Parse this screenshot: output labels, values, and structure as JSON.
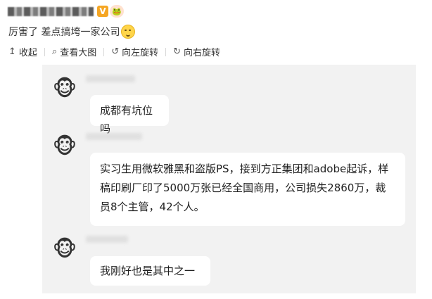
{
  "post": {
    "v_badge": "V",
    "level_badge": "🐸",
    "text": "厉害了 差点搞垮一家公司",
    "emoji": "sneaky-smile-emoji"
  },
  "toolbar": {
    "collapse": "收起",
    "view_large": "查看大图",
    "rotate_left": "向左旋转",
    "rotate_right": "向右旋转",
    "icons": {
      "collapse": "↥",
      "view_large": "⌕",
      "rotate_left": "↺",
      "rotate_right": "↻"
    }
  },
  "chat": {
    "avatar_glyph": "🐵",
    "messages": [
      {
        "text": "成都有坑位吗"
      },
      {
        "text": "实习生用微软雅黑和盗版PS，接到方正集团和adobe起诉，样稿印刷厂印了5000万张已经全国商用，公司损失2860万，裁员8个主管，42个人。"
      },
      {
        "text": "我刚好也是其中之一"
      }
    ]
  }
}
